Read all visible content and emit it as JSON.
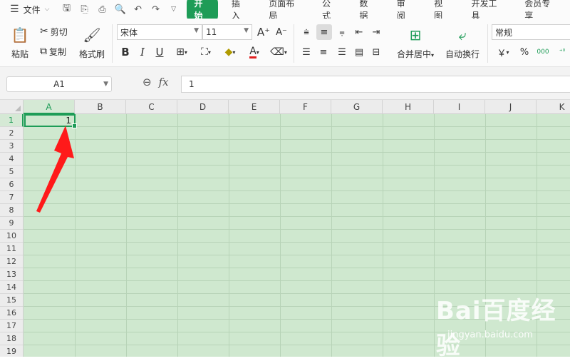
{
  "menu": {
    "file_label": "文件",
    "tabs": [
      "开始",
      "插入",
      "页面布局",
      "公式",
      "数据",
      "审阅",
      "视图",
      "开发工具",
      "会员专享"
    ],
    "active_tab": "开始"
  },
  "ribbon": {
    "paste_label": "粘贴",
    "cut_label": "剪切",
    "copy_label": "复制",
    "format_painter_label": "格式刷",
    "font_name": "宋体",
    "font_size": "11",
    "merge_label": "合并居中",
    "wrap_label": "自动换行",
    "number_format": "常规",
    "currency_symbol": "￥",
    "percent_symbol": "%",
    "thousands_symbol": "000"
  },
  "formula_bar": {
    "name_box": "A1",
    "fx_label": "fx",
    "value": "1"
  },
  "sheet": {
    "columns": [
      "A",
      "B",
      "C",
      "D",
      "E",
      "F",
      "G",
      "H",
      "I",
      "J",
      "K"
    ],
    "rows": [
      "1",
      "2",
      "3",
      "4",
      "5",
      "6",
      "7",
      "8",
      "9",
      "10",
      "11",
      "12",
      "13",
      "14",
      "15",
      "16",
      "17",
      "18",
      "19"
    ],
    "active_cell_value": "1"
  },
  "watermark": {
    "brand": "Bai百度经验",
    "url": "jingyan.baidu.com"
  },
  "colors": {
    "accent": "#1e9c57",
    "sheet_bg": "#cfe8cf",
    "arrow": "#ff1a1a"
  }
}
